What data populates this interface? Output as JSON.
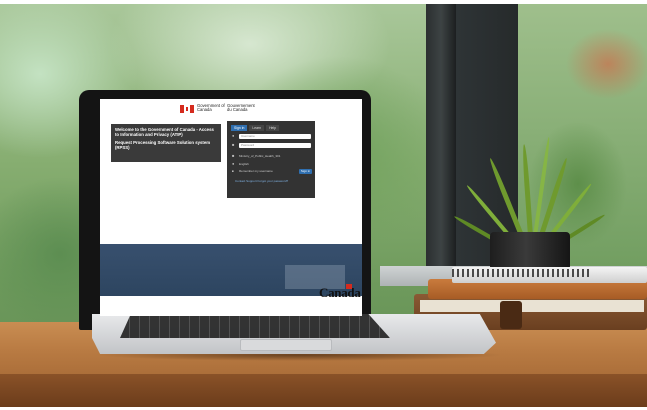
{
  "screen": {
    "gov_en": "Government of Canada",
    "gov_fr": "Gouvernement du Canada",
    "welcome_line1": "Welcome to the Government of Canada - Access to Information and Privacy (ATIP)",
    "welcome_line2": "Request Processing Software Solution system (RPSS)",
    "tabs": [
      "Sign in",
      "Learn",
      "Help"
    ],
    "username_placeholder": "Username",
    "password_placeholder": "Password",
    "domain_value": "Ministry_of_Public_Health_301",
    "english_label": "English",
    "remember_label": "Remember my username",
    "signin_label": "Sign in",
    "support_text": "Contact Support    Forgot your password?",
    "wordmark": "Canada"
  },
  "colors": {
    "gov_red": "#d52b1e",
    "panel_dark": "#333333",
    "accent_blue": "#2f6fb0",
    "banner_navy": "#38506e"
  }
}
